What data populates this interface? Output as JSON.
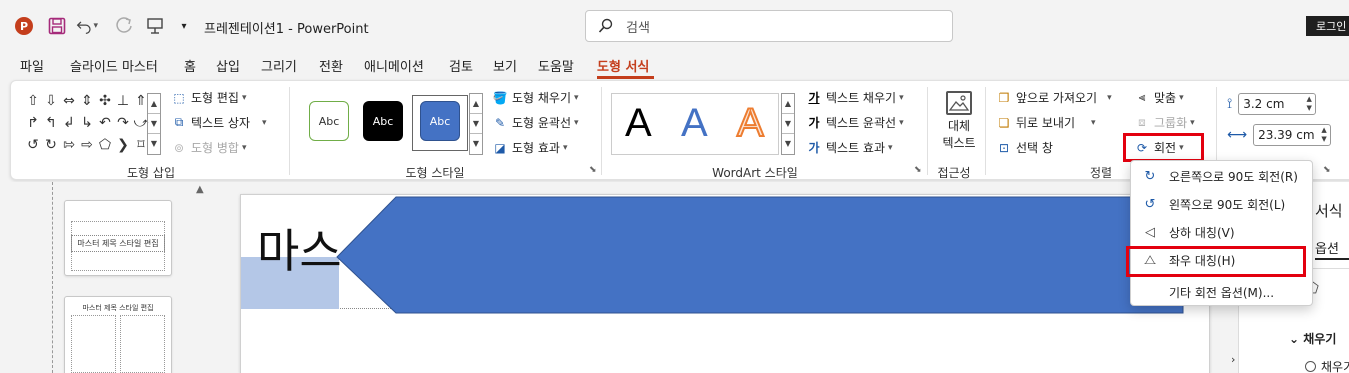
{
  "titlebar": {
    "doc_title": "프레젠테이션1  -  PowerPoint",
    "search_placeholder": "검색",
    "login_label": "로그인",
    "app_logo_letter": "P"
  },
  "tabs": [
    "파일",
    "슬라이드 마스터",
    "홈",
    "삽입",
    "그리기",
    "전환",
    "애니메이션",
    "검토",
    "보기",
    "도움말",
    "도형 서식"
  ],
  "active_tab": "도형 서식",
  "ribbon": {
    "insert_shapes": {
      "label": "도형 삽입",
      "edit_shape": "도형 편집",
      "text_box": "텍스트 상자",
      "merge_shapes": "도형 병합"
    },
    "shape_styles": {
      "label": "도형 스타일",
      "presets": [
        "Abc",
        "Abc",
        "Abc"
      ],
      "fill": "도형 채우기",
      "outline": "도형 윤곽선",
      "effects": "도형 효과"
    },
    "wordart": {
      "label": "WordArt 스타일",
      "letters": [
        "A",
        "A",
        "A"
      ],
      "text_fill": "텍스트 채우기",
      "text_outline": "텍스트 윤곽선",
      "text_effects": "텍스트 효과",
      "fill_glyph": "가",
      "outline_glyph": "가",
      "effects_glyph": "가"
    },
    "accessibility": {
      "label": "접근성",
      "alt_text_line1": "대체",
      "alt_text_line2": "텍스트"
    },
    "arrange": {
      "label": "정렬",
      "bring_forward": "앞으로 가져오기",
      "send_backward": "뒤로 보내기",
      "selection_pane": "선택 창",
      "align": "맞춤",
      "group": "그룹화",
      "rotate": "회전"
    },
    "size": {
      "height": "3.2 cm",
      "width": "23.39 cm"
    }
  },
  "rotate_menu": {
    "items": [
      {
        "label": "오른쪽으로 90도 회전(R)"
      },
      {
        "label": "왼쪽으로 90도 회전(L)"
      },
      {
        "label": "상하 대칭(V)"
      },
      {
        "label": "좌우 대칭(H)"
      },
      {
        "label": "기타 회전 옵션(M)..."
      }
    ]
  },
  "slides": {
    "thumb1_title": "마스터 제목 스타일 편집",
    "thumb2_title": "마스터 제목 스타일 편집",
    "main_title": "마스",
    "chev_mark": "›"
  },
  "format_pane": {
    "title": "서식",
    "tab": "옵션",
    "fill_section": "채우기",
    "fill_option": "채우기"
  },
  "colors": {
    "accent": "#c43e1c",
    "shape_fill": "#4472c4",
    "light_fill": "#b4c7e7",
    "highlight": "#e3000f"
  }
}
